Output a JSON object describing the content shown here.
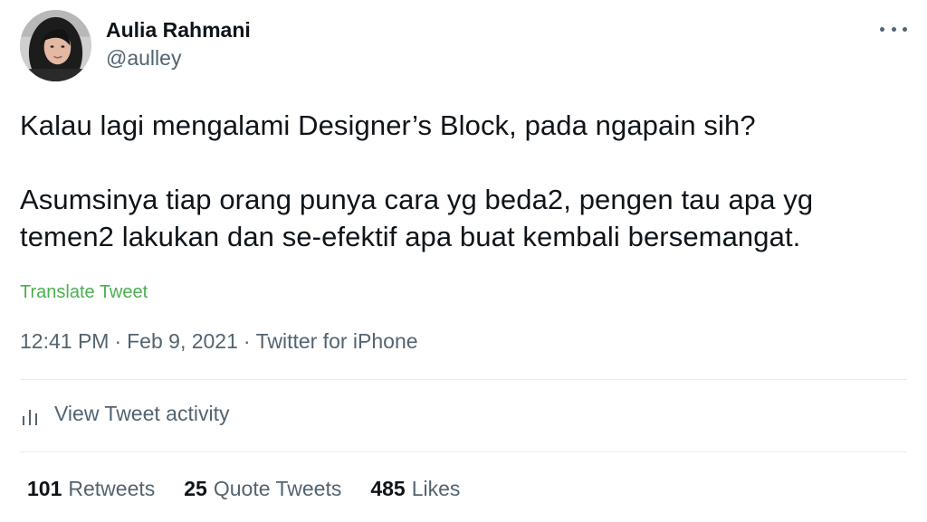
{
  "author": {
    "display_name": "Aulia Rahmani",
    "handle": "@aulley",
    "avatar_icon": "avatar-photo"
  },
  "more_menu_icon": "more-horizontal-icon",
  "tweet": {
    "line1": "Kalau lagi mengalami Designer’s Block, pada ngapain sih?",
    "line2": "Asumsinya tiap orang punya cara yg beda2, pengen tau apa yg",
    "line3": "temen2 lakukan dan se-efektif apa buat kembali bersemangat."
  },
  "translate_label": "Translate Tweet",
  "meta": {
    "time": "12:41 PM",
    "date": "Feb 9, 2021",
    "source": "Twitter for iPhone",
    "separator": "·"
  },
  "activity": {
    "label": "View Tweet activity",
    "icon": "analytics-bars-icon"
  },
  "stats": {
    "retweets_count": "101",
    "retweets_label": "Retweets",
    "quotes_count": "25",
    "quotes_label": "Quote Tweets",
    "likes_count": "485",
    "likes_label": "Likes"
  },
  "colors": {
    "text_primary": "#0f1419",
    "text_secondary": "#536471",
    "translate_green": "#4caf50",
    "divider": "#e6ecf0"
  }
}
